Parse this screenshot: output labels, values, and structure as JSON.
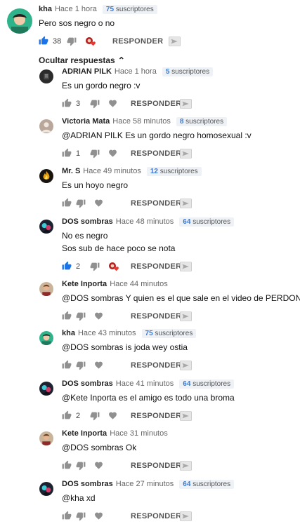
{
  "colors": {
    "like_active": "#1a73e8",
    "icon_grey": "#909090",
    "badge_bg": "#eef1f5",
    "badge_num": "#3a7bd5"
  },
  "reply_label": "RESPONDER",
  "badge_word": "suscriptores",
  "hide_replies": "Ocultar respuestas",
  "top": {
    "author": "kha",
    "time": "Hace 1 hora",
    "subs": "75",
    "lines": [
      "Pero sos negro o no"
    ],
    "likes": "38",
    "liked": true,
    "heart": true
  },
  "replies": [
    {
      "author": "ADRIAN PILK",
      "time": "Hace 1 hora",
      "subs": "5",
      "lines": [
        "Es un gordo negro :v"
      ],
      "likes": "3",
      "liked": false,
      "heart": false,
      "avatar_icon": "dark-avatar-icon"
    },
    {
      "author": "Victoria Mata",
      "time": "Hace 58 minutos",
      "subs": "8",
      "lines": [
        "@ADRIAN PILK Es un gordo negro homosexual :v"
      ],
      "likes": "1",
      "liked": false,
      "heart": false,
      "avatar_icon": "default-avatar-icon"
    },
    {
      "author": "Mr. S",
      "time": "Hace 49 minutos",
      "subs": "12",
      "lines": [
        "Es un hoyo negro"
      ],
      "likes": "",
      "liked": false,
      "heart": false,
      "avatar_icon": "flame-avatar-icon"
    },
    {
      "author": "DOS sombras",
      "time": "Hace 48 minutos",
      "subs": "64",
      "lines": [
        "No es negro",
        "Sos sub de hace poco se nota"
      ],
      "likes": "2",
      "liked": true,
      "heart": true,
      "avatar_icon": "dos-sombras-avatar-icon"
    },
    {
      "author": "Kete Inporta",
      "time": "Hace 44 minutos",
      "subs": "",
      "lines": [
        "@DOS sombras Y quien es el que sale en el video de PERDON"
      ],
      "likes": "",
      "liked": false,
      "heart": false,
      "avatar_icon": "kete-avatar-icon"
    },
    {
      "author": "kha",
      "time": "Hace 43 minutos",
      "subs": "75",
      "lines": [
        "@DOS sombras is joda wey ostia"
      ],
      "likes": "",
      "liked": false,
      "heart": false,
      "avatar_icon": "kha-avatar-icon"
    },
    {
      "author": "DOS sombras",
      "time": "Hace 41 minutos",
      "subs": "64",
      "lines": [
        "@Kete Inporta es el amigo es todo una broma"
      ],
      "likes": "2",
      "liked": false,
      "heart": false,
      "avatar_icon": "dos-sombras-avatar-icon"
    },
    {
      "author": "Kete Inporta",
      "time": "Hace 31 minutos",
      "subs": "",
      "lines": [
        "@DOS sombras Ok"
      ],
      "likes": "",
      "liked": false,
      "heart": false,
      "avatar_icon": "kete-avatar-icon"
    },
    {
      "author": "DOS sombras",
      "time": "Hace 27 minutos",
      "subs": "64",
      "lines": [
        "@kha xd"
      ],
      "likes": "",
      "liked": false,
      "heart": false,
      "avatar_icon": "dos-sombras-avatar-icon"
    }
  ]
}
